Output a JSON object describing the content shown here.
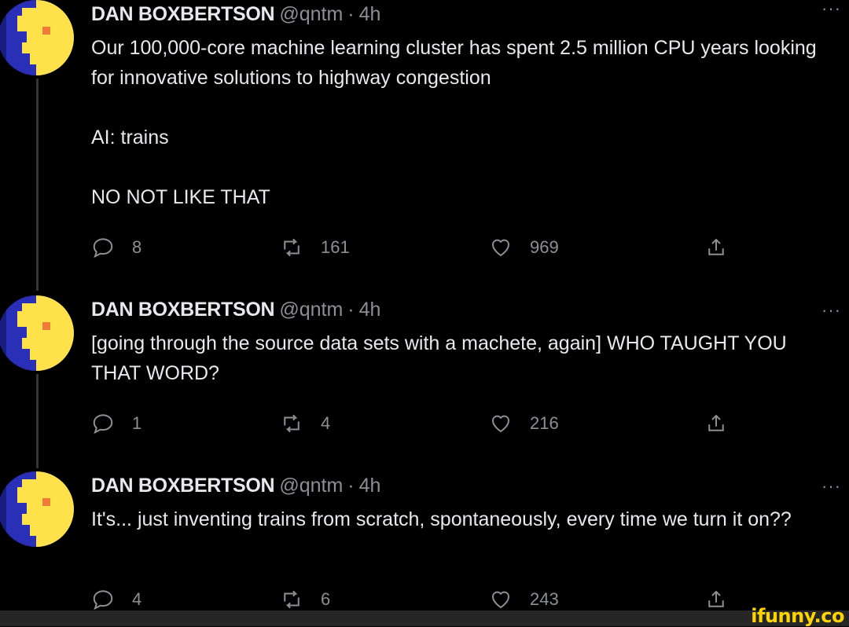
{
  "tweets": [
    {
      "name": "DAN BOXBERTSON",
      "handle": "@qntm",
      "separator": "·",
      "time": "4h",
      "more": "···",
      "text": "Our 100,000-core machine learning cluster has spent 2.5 million CPU years looking for innovative solutions to highway congestion\n\nAI: trains\n\nNO NOT LIKE THAT",
      "replies": "8",
      "retweets": "161",
      "likes": "969"
    },
    {
      "name": "DAN BOXBERTSON",
      "handle": "@qntm",
      "separator": "·",
      "time": "4h",
      "more": "···",
      "text": "[going through the source data sets with a machete, again] WHO TAUGHT YOU THAT WORD?",
      "replies": "1",
      "retweets": "4",
      "likes": "216"
    },
    {
      "name": "DAN BOXBERTSON",
      "handle": "@qntm",
      "separator": "·",
      "time": "4h",
      "more": "···",
      "text": "It's... just inventing trains from scratch, spontaneously, every time we turn it on??",
      "replies": "4",
      "retweets": "6",
      "likes": "243"
    }
  ],
  "watermark": "ifunny.co",
  "icons": {
    "reply": "reply-icon",
    "retweet": "retweet-icon",
    "like": "heart-icon",
    "share": "share-icon",
    "avatar": "avatar"
  },
  "colors": {
    "background": "#000000",
    "text": "#e7e9ea",
    "muted": "#8b9096",
    "watermark": "#ffd400"
  }
}
